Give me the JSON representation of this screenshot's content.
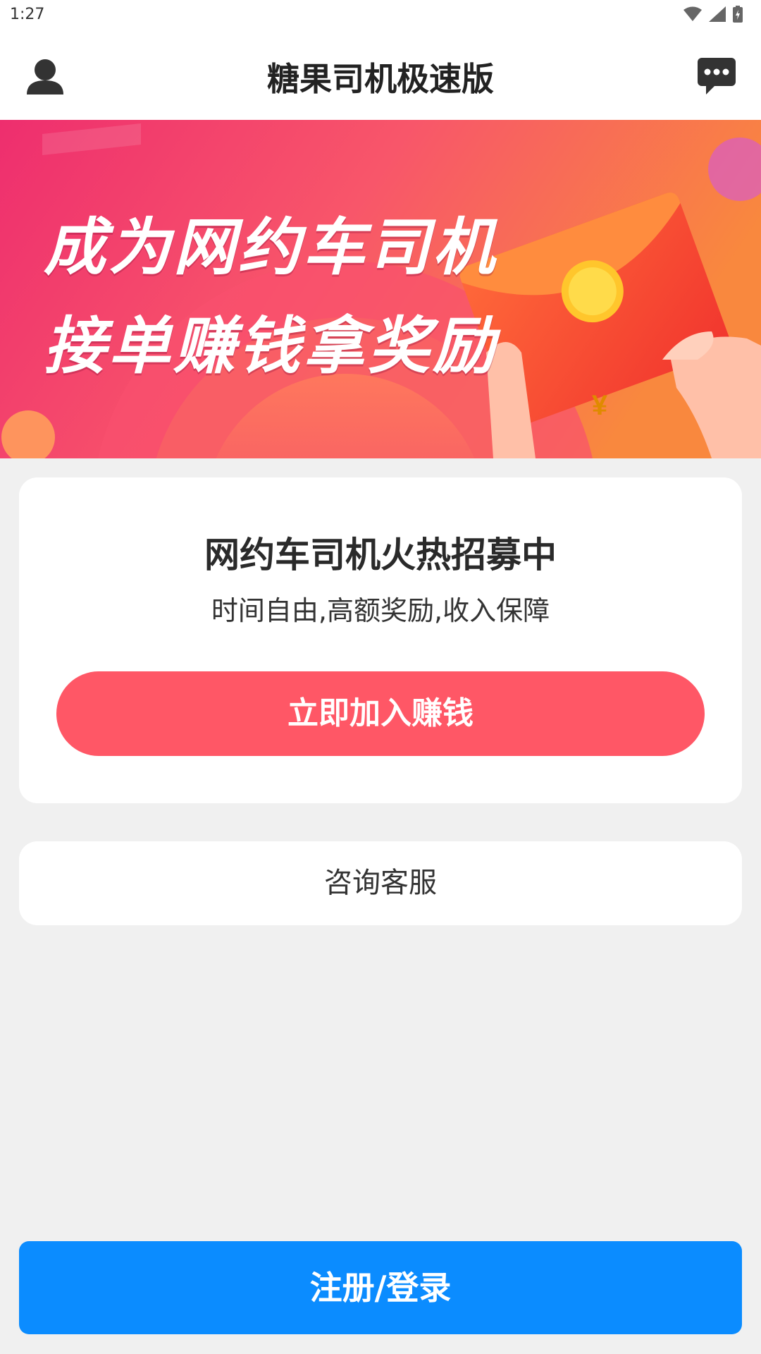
{
  "status_bar": {
    "time": "1:27"
  },
  "header": {
    "title": "糖果司机极速版",
    "left_icon": "user-icon",
    "right_icon": "message-icon"
  },
  "banner": {
    "line1": "成为网约车司机",
    "line2": "接单赚钱拿奖励",
    "coin_symbol": "¥"
  },
  "recruit_card": {
    "title": "网约车司机火热招募中",
    "subtitle": "时间自由,高额奖励,收入保障",
    "join_button": "立即加入赚钱"
  },
  "service_card": {
    "label": "咨询客服"
  },
  "footer": {
    "login_button": "注册/登录"
  },
  "colors": {
    "join_button": "#ff5766",
    "login_button": "#0b8cff",
    "background": "#f0f0f0"
  }
}
